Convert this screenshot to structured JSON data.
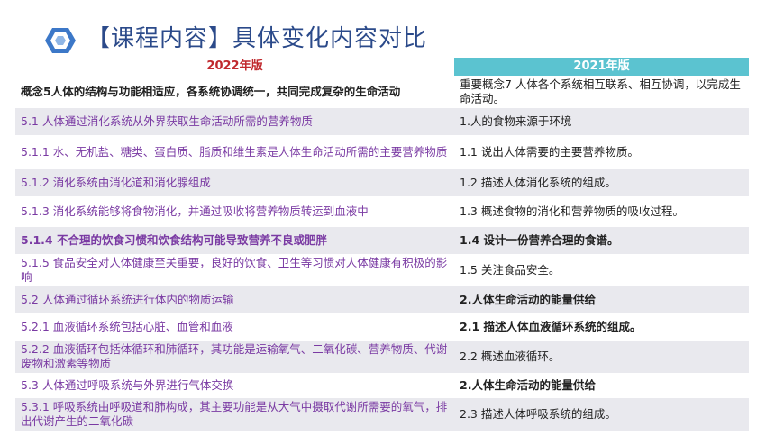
{
  "header": {
    "title": "【课程内容】具体变化内容对比"
  },
  "columns": {
    "left": "2022年版",
    "right": "2021年版"
  },
  "rows": [
    {
      "left": "概念5人体的结构与功能相适应，各系统协调统一，共同完成复杂的生命活动",
      "right": "重要概念7 人体各个系统相互联系、相互协调，以完成生命活动。"
    },
    {
      "left": "5.1 人体通过消化系统从外界获取生命活动所需的营养物质",
      "right": "1.人的食物来源于环境"
    },
    {
      "left": "5.1.1 水、无机盐、糖类、蛋白质、脂质和维生素是人体生命活动所需的主要营养物质",
      "right": "1.1 说出人体需要的主要营养物质。"
    },
    {
      "left": "5.1.2 消化系统由消化道和消化腺组成",
      "right": "1.2 描述人体消化系统的组成。"
    },
    {
      "left": "5.1.3 消化系统能够将食物消化，并通过吸收将营养物质转运到血液中",
      "right": "1.3 概述食物的消化和营养物质的吸收过程。"
    },
    {
      "left": "5.1.4 不合理的饮食习惯和饮食结构可能导致营养不良或肥胖",
      "right": "1.4 设计一份营养合理的食谱。"
    },
    {
      "left": "5.1.5 食品安全对人体健康至关重要，良好的饮食、卫生等习惯对人体健康有积极的影响",
      "right": "1.5 关注食品安全。"
    },
    {
      "left": "5.2 人体通过循环系统进行体内的物质运输",
      "right": "2.人体生命活动的能量供给"
    },
    {
      "left": "5.2.1 血液循环系统包括心脏、血管和血液",
      "right": "2.1 描述人体血液循环系统的组成。"
    },
    {
      "left": "5.2.2 血液循环包括体循环和肺循环，其功能是运输氧气、二氧化碳、营养物质、代谢废物和激素等物质",
      "right": "2.2 概述血液循环。"
    },
    {
      "left": "5.3 人体通过呼吸系统与外界进行气体交换",
      "right": "2.人体生命活动的能量供给"
    },
    {
      "left": "5.3.1 呼吸系统由呼吸道和肺构成，其主要功能是从大气中摄取代谢所需要的氧气，排出代谢产生的二氧化碳",
      "right": "2.3 描述人体呼吸系统的组成。"
    }
  ]
}
